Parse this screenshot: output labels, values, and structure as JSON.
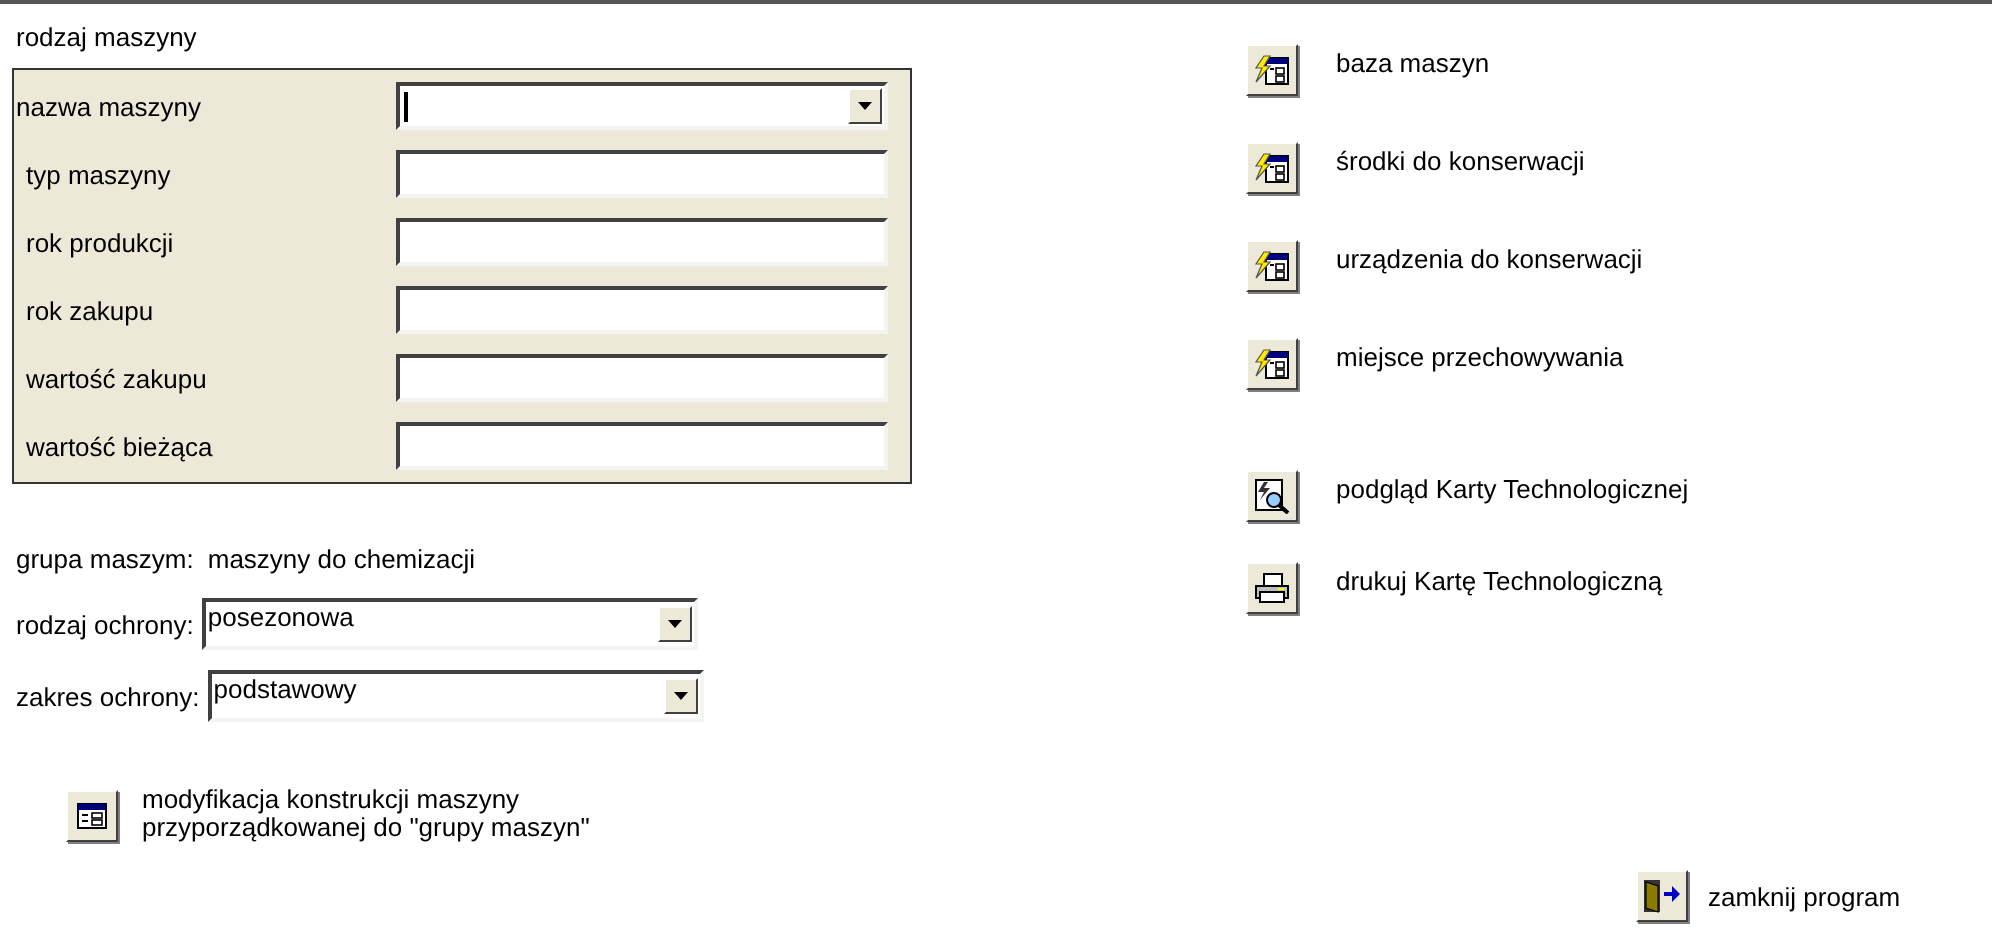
{
  "section_title": "rodzaj maszyny",
  "fields": [
    {
      "label": "nazwa maszyny",
      "kind": "combo",
      "focused": true
    },
    {
      "label": "typ maszyny",
      "kind": "text",
      "focused": false
    },
    {
      "label": "rok produkcji",
      "kind": "text",
      "focused": false
    },
    {
      "label": "rok zakupu",
      "kind": "text",
      "focused": false
    },
    {
      "label": "wartość zakupu",
      "kind": "text",
      "focused": false
    },
    {
      "label": "wartość bieżąca",
      "kind": "text",
      "focused": false
    }
  ],
  "group": {
    "label": "grupa maszym:",
    "value": "maszyny do chemizacji"
  },
  "protection": [
    {
      "label": "rodzaj ochrony:",
      "value": "posezonowa"
    },
    {
      "label": "zakres ochrony:",
      "value": "podstawowy"
    }
  ],
  "modify_button": {
    "label": "modyfikacja konstrukcji maszyny\nprzyporządkowanej do \"grupy maszyn\""
  },
  "actions": [
    {
      "label": "baza maszyn",
      "kind": "form"
    },
    {
      "label": "środki do konserwacji",
      "kind": "form"
    },
    {
      "label": "urządzenia do konserwacji",
      "kind": "form"
    },
    {
      "label": "miejsce przechowywania",
      "kind": "form"
    },
    {
      "label": "podgląd Karty Technologicznej",
      "kind": "preview"
    },
    {
      "label": "drukuj Kartę Technologiczną",
      "kind": "print"
    }
  ],
  "exit_button": {
    "label": "zamknij program"
  }
}
